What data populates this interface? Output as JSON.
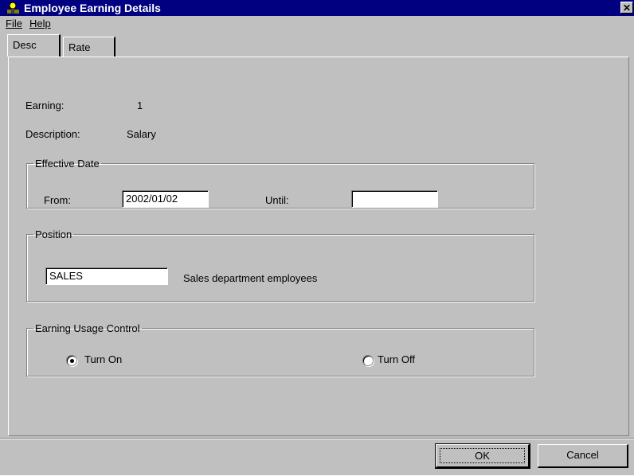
{
  "window": {
    "title": "Employee Earning Details",
    "close_label": "✕"
  },
  "menu": {
    "file": "File",
    "help": "Help"
  },
  "tabs": [
    "Desc",
    "Rate"
  ],
  "desc": {
    "earning_label": "Earning:",
    "earning_value": "1",
    "description_label": "Description:",
    "description_value": "Salary",
    "effective_date": {
      "legend": "Effective Date",
      "from_label": "From:",
      "from_value": "2002/01/02",
      "until_label": "Until:",
      "until_value": ""
    },
    "position": {
      "legend": "Position",
      "code": "SALES",
      "description": "Sales department employees"
    },
    "usage": {
      "legend": "Earning Usage Control",
      "turn_on": "Turn On",
      "turn_off": "Turn Off",
      "selected": "turn_on"
    }
  },
  "buttons": {
    "ok": "OK",
    "cancel": "Cancel"
  }
}
